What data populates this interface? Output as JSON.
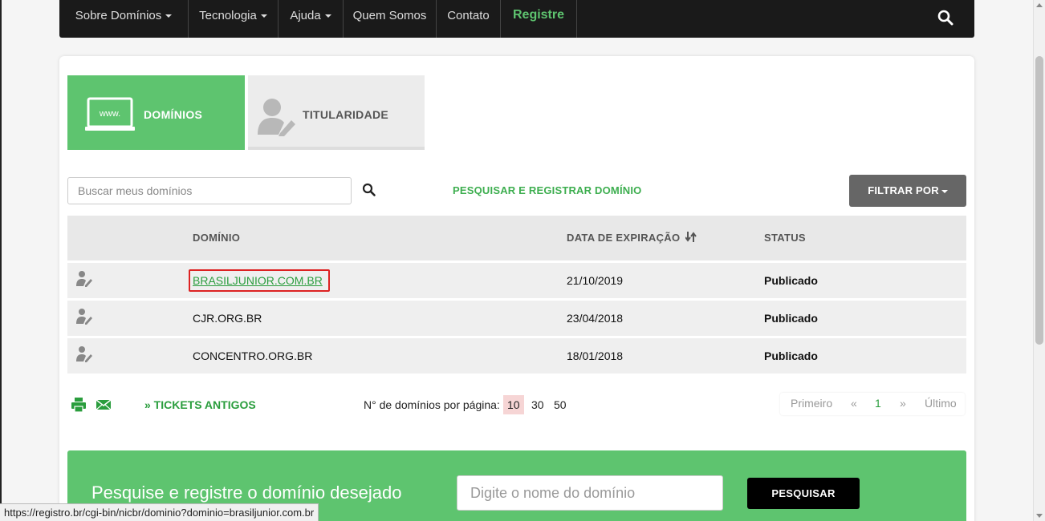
{
  "nav": {
    "items": [
      {
        "label": "Sobre Domínios",
        "has_caret": true
      },
      {
        "label": "Tecnologia",
        "has_caret": true
      },
      {
        "label": "Ajuda",
        "has_caret": true
      },
      {
        "label": "Quem Somos",
        "has_caret": false
      },
      {
        "label": "Contato",
        "has_caret": false
      }
    ],
    "register_label": "Registre",
    "search_icon": "search-icon"
  },
  "tabs": {
    "domains": {
      "label": "DOMÍNIOS",
      "icon_text": "www.",
      "icon": "laptop-icon"
    },
    "ownership": {
      "label": "TITULARIDADE",
      "icon": "user-edit-icon"
    }
  },
  "toolbar": {
    "search_placeholder": "Buscar meus domínios",
    "register_link": "PESQUISAR E REGISTRAR DOMÍNIO",
    "filter_label": "FILTRAR POR"
  },
  "table": {
    "headers": {
      "domain": "DOMÍNIO",
      "expiration": "DATA DE EXPIRAÇÃO",
      "status": "STATUS"
    },
    "rows": [
      {
        "domain": "BRASILJUNIOR.COM.BR",
        "expiration": "21/10/2019",
        "status": "Publicado"
      },
      {
        "domain": "CJR.ORG.BR",
        "expiration": "23/04/2018",
        "status": "Publicado"
      },
      {
        "domain": "CONCENTRO.ORG.BR",
        "expiration": "18/01/2018",
        "status": "Publicado"
      }
    ]
  },
  "footer": {
    "tickets_label": "» TICKETS ANTIGOS",
    "per_page_label": "N° de domínios por página:",
    "per_page_options": [
      "10",
      "30",
      "50"
    ],
    "per_page_selected": "10",
    "pager": {
      "first": "Primeiro",
      "prev": "«",
      "current": "1",
      "next": "»",
      "last": "Último"
    }
  },
  "banner": {
    "text": "Pesquise e registre o domínio desejado",
    "input_placeholder": "Digite o nome do domínio",
    "button_label": "PESQUISAR"
  },
  "statusbar": {
    "url": "https://registro.br/cgi-bin/nicbr/dominio?dominio=brasiljunior.com.br"
  },
  "colors": {
    "brand_green": "#5ec46f",
    "link_green": "#2a9d3d",
    "nav_bg": "#1a1a1a",
    "highlight_red": "#d22222"
  }
}
